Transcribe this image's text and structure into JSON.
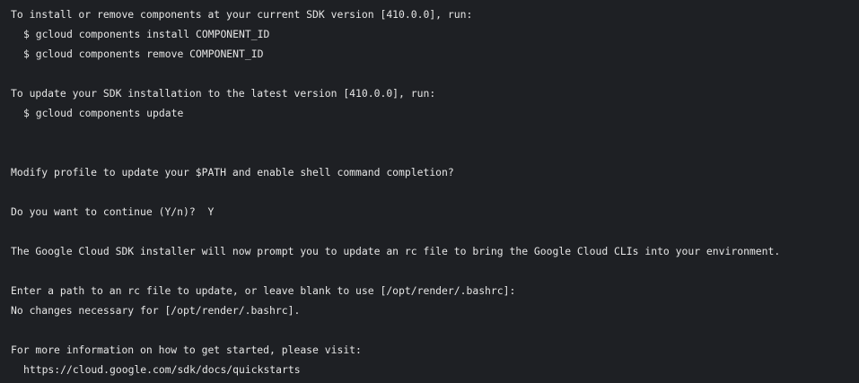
{
  "terminal": {
    "lines": [
      "To install or remove components at your current SDK version [410.0.0], run:",
      "$ gcloud components install COMPONENT_ID",
      "$ gcloud components remove COMPONENT_ID",
      "",
      "To update your SDK installation to the latest version [410.0.0], run:",
      "$ gcloud components update",
      "",
      "",
      "Modify profile to update your $PATH and enable shell command completion?",
      "",
      "Do you want to continue (Y/n)?  Y",
      "",
      "The Google Cloud SDK installer will now prompt you to update an rc file to bring the Google Cloud CLIs into your environment.",
      "",
      "Enter a path to an rc file to update, or leave blank to use [/opt/render/.bashrc]:",
      "No changes necessary for [/opt/render/.bashrc].",
      "",
      "For more information on how to get started, please visit:",
      "https://cloud.google.com/sdk/docs/quickstarts"
    ]
  }
}
